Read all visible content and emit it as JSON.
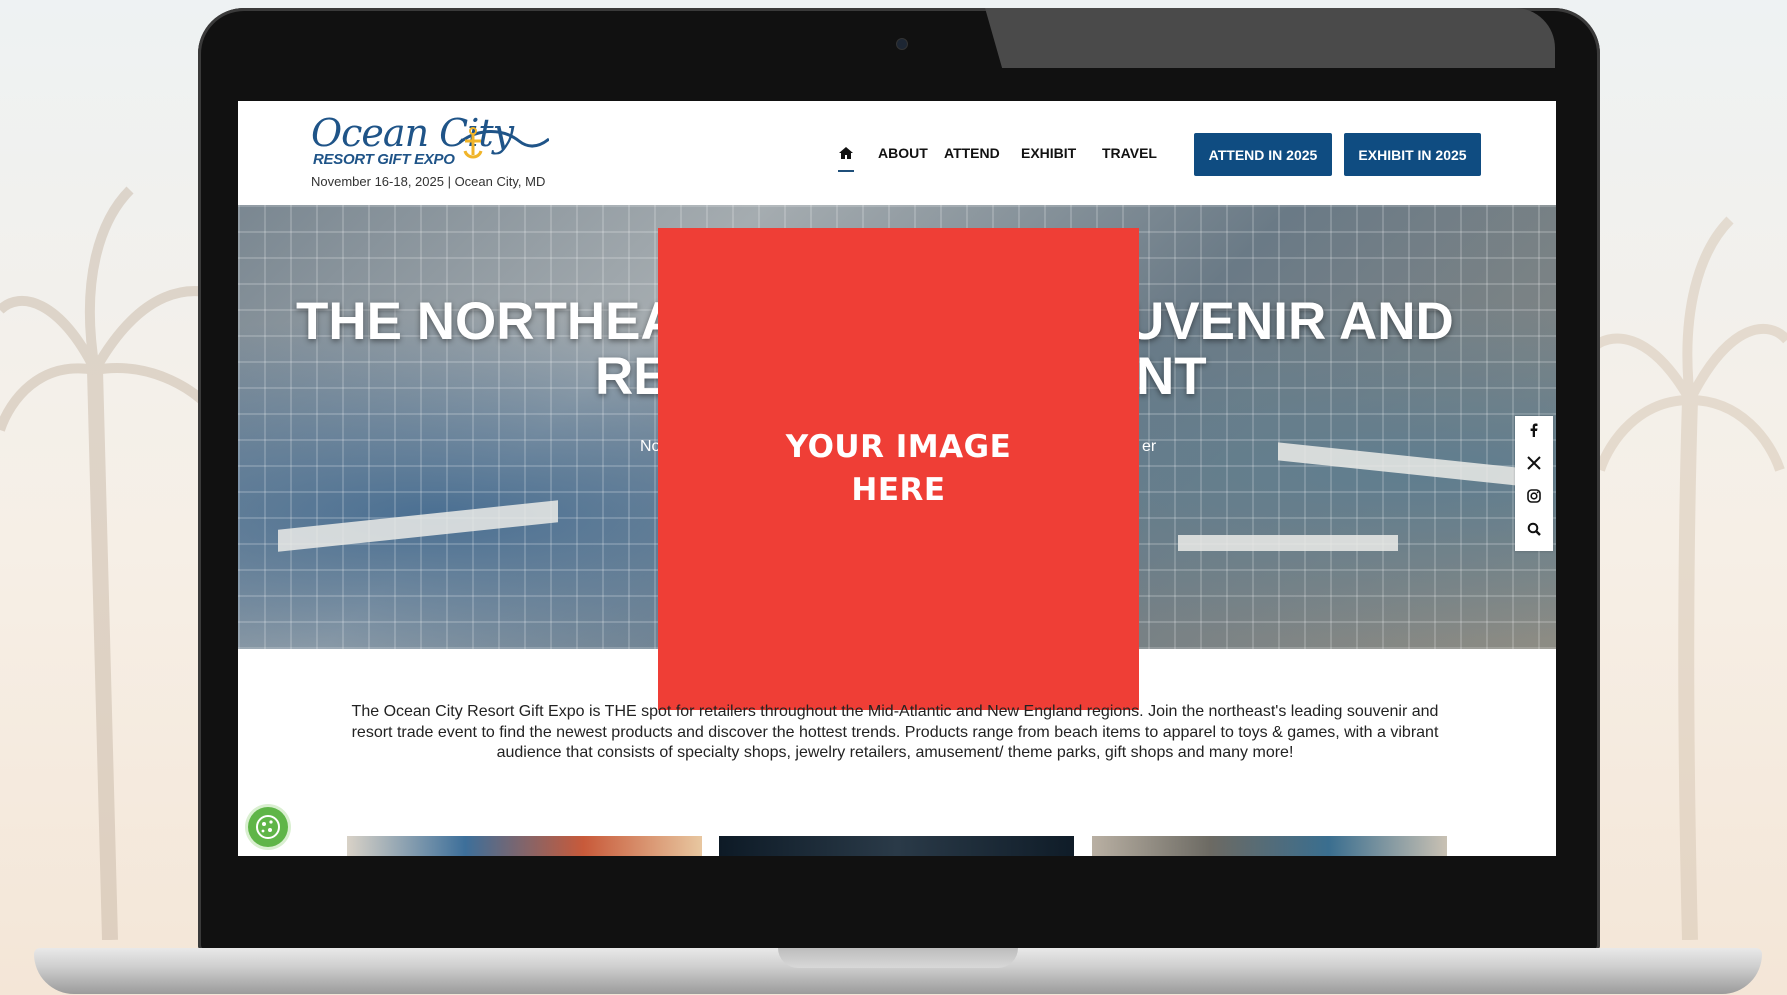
{
  "site": {
    "logo_main": "Ocean City",
    "logo_sub": "RESORT GIFT EXPO",
    "event_info": "November 16-18, 2025 | Ocean City, MD"
  },
  "nav": {
    "home_icon": "home-icon",
    "items": [
      "ABOUT",
      "ATTEND",
      "EXHIBIT",
      "TRAVEL"
    ],
    "attend_button": "ATTEND IN 2025",
    "exhibit_button": "EXHIBIT IN 2025"
  },
  "hero": {
    "title_line1_left": "THE NORTHEA",
    "title_line1_right": "UVENIR AND",
    "title_line2_left": "RE",
    "title_line2_right": "NT",
    "subtitle_left": "No",
    "subtitle_right": "er"
  },
  "placeholder": {
    "line1": "YOUR IMAGE",
    "line2": "HERE"
  },
  "social": [
    "facebook-icon",
    "x-icon",
    "instagram-icon",
    "search-icon"
  ],
  "intro_text": "The Ocean City Resort Gift Expo is THE spot for retailers throughout the Mid-Atlantic and New England regions. Join the northeast's leading souvenir and resort trade event to find the newest products and discover the hottest trends. Products range from beach items to apparel to toys & games, with a vibrant audience that consists of specialty shops, jewelry retailers, amusement/ theme parks, gift shops and many more!",
  "colors": {
    "brand_blue": "#0f4c81",
    "placeholder_red": "#ef3e36",
    "cookie_green": "#5fb548"
  }
}
